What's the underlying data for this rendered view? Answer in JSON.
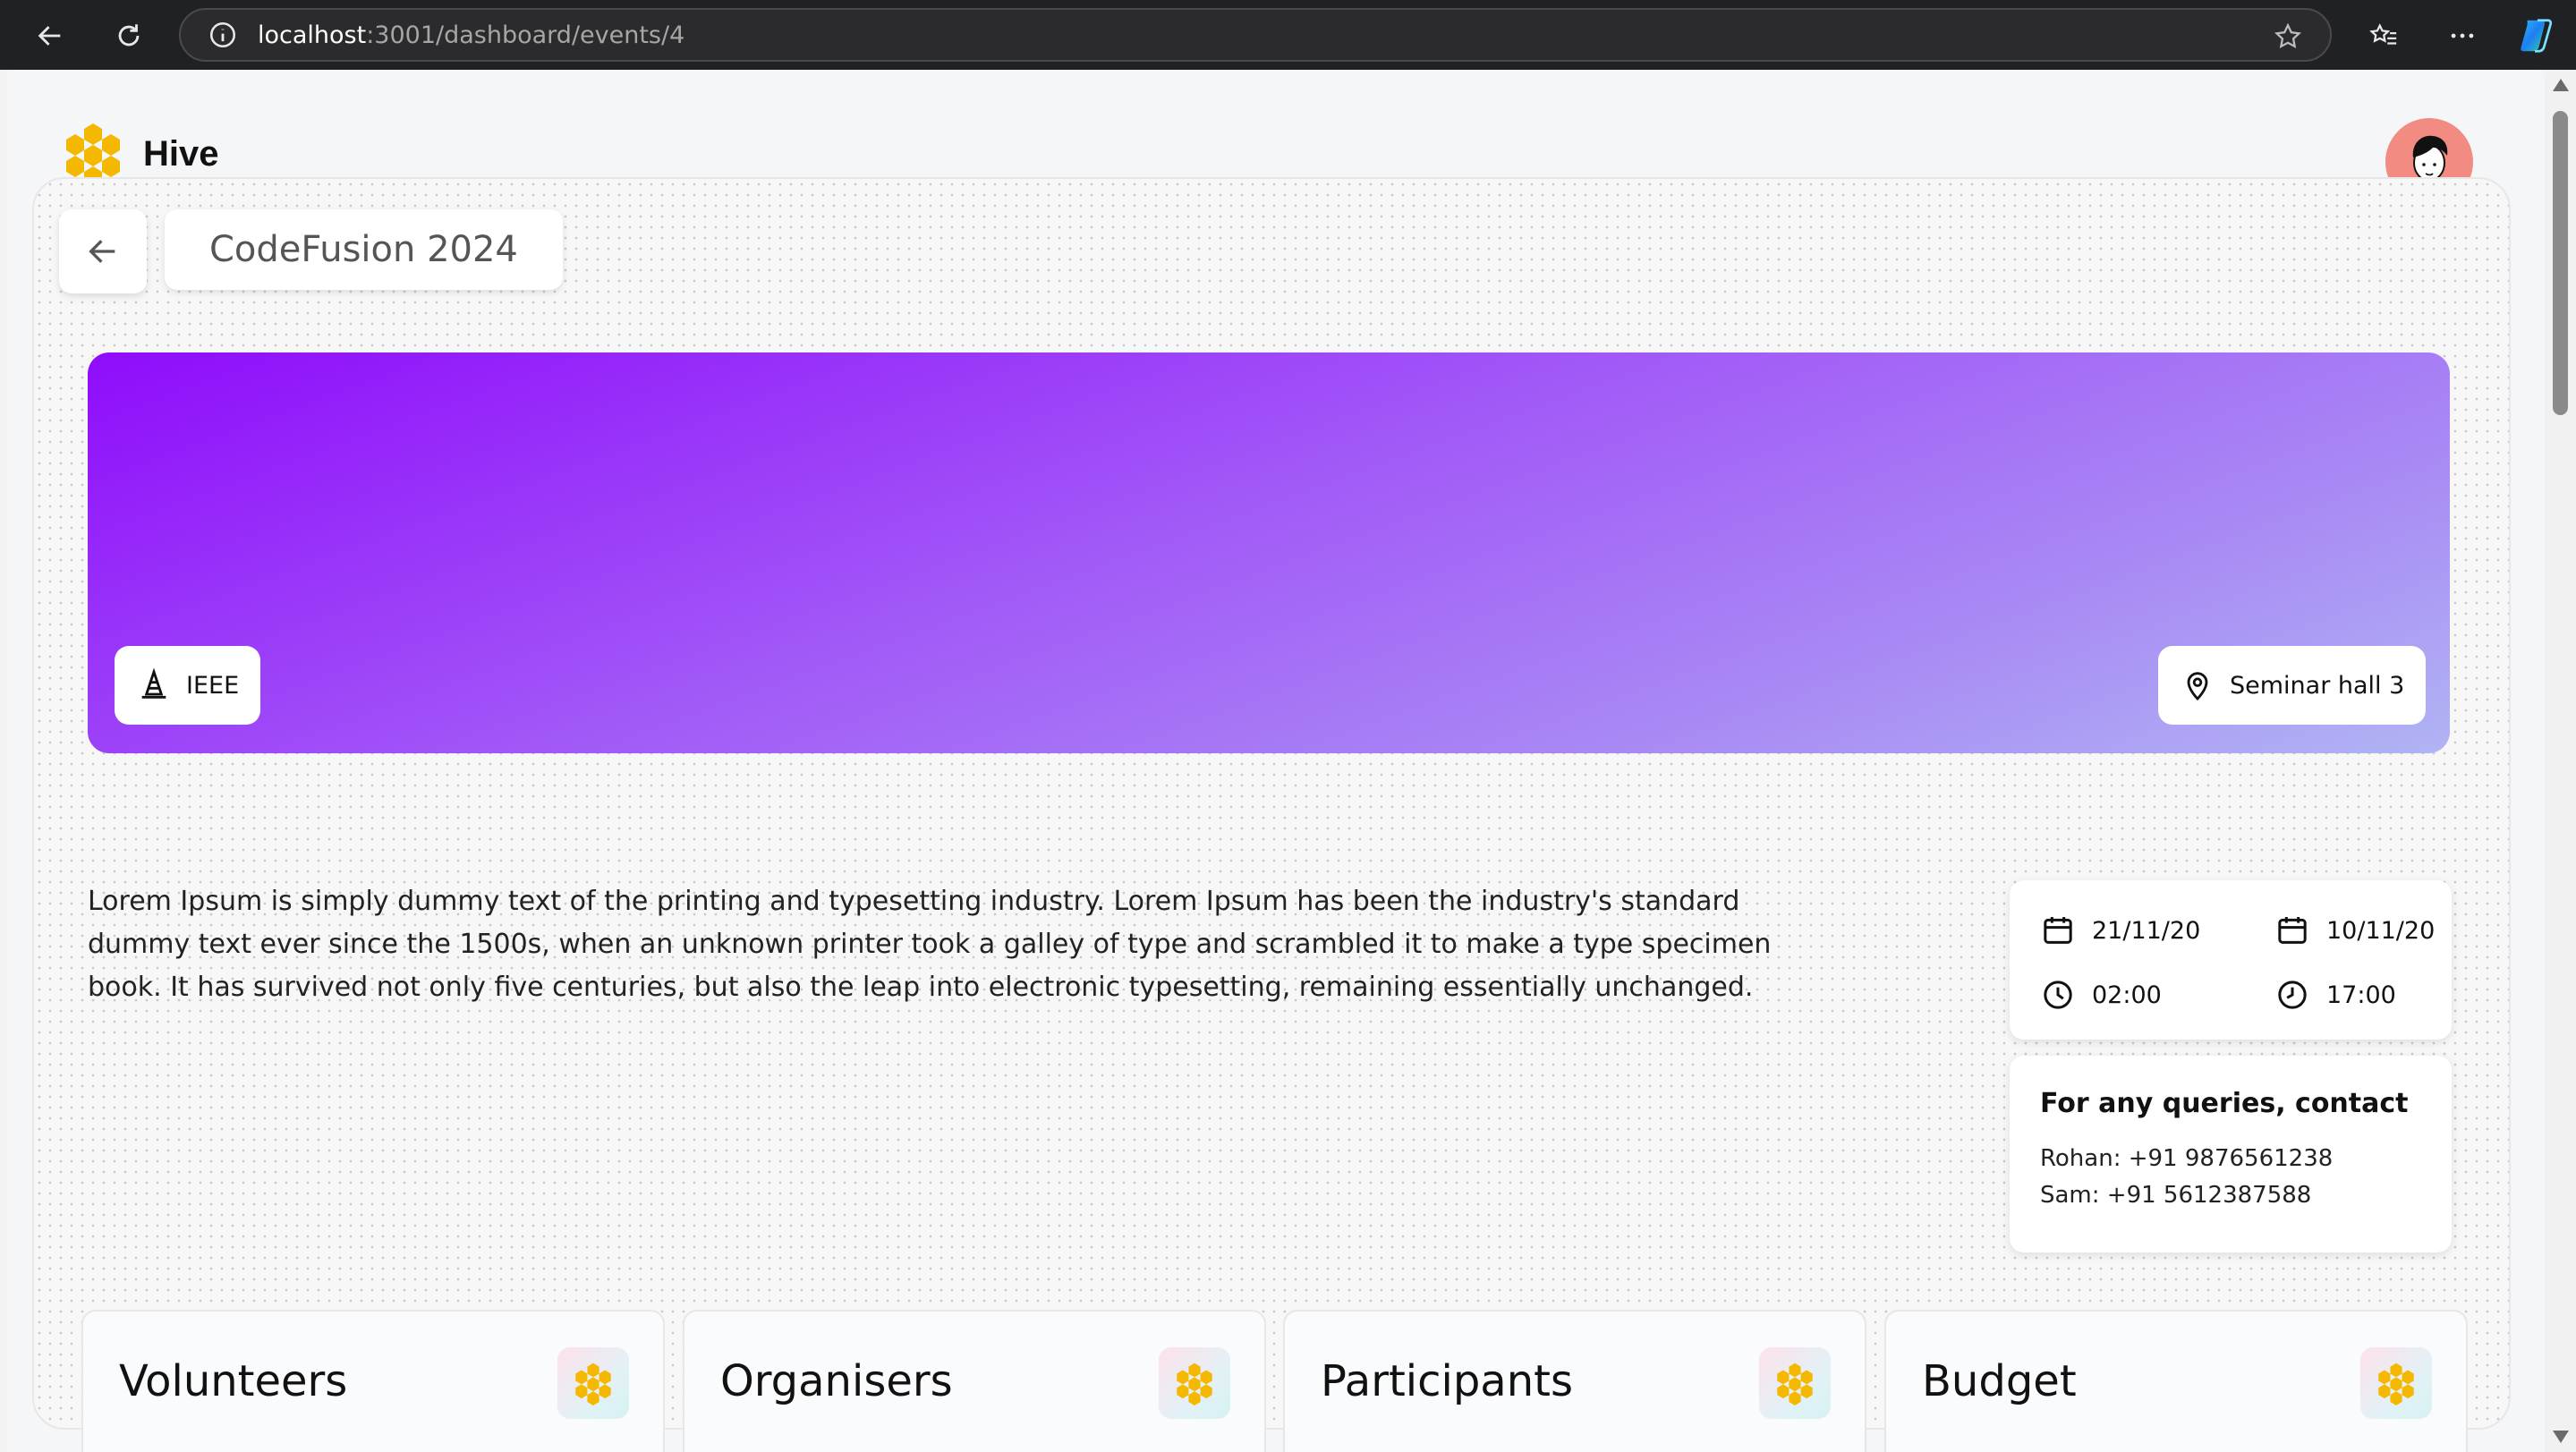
{
  "browser": {
    "url_host": "localhost",
    "url_rest": ":3001/dashboard/events/4"
  },
  "app": {
    "name": "Hive",
    "brand_color": "#F5B800"
  },
  "event": {
    "title": "CodeFusion 2024",
    "organizer": "IEEE",
    "location": "Seminar hall 3",
    "description": "Lorem Ipsum is simply dummy text of the printing and typesetting industry. Lorem Ipsum has been the industry's standard dummy text ever since the 1500s, when an unknown printer took a galley of type and scrambled it to make a type specimen book. It has survived not only five centuries, but also the leap into electronic typesetting, remaining essentially unchanged.",
    "banner_gradient": [
      "#8F0CFB",
      "#A259F7",
      "#A98DF4",
      "#B0B4F4"
    ],
    "start_date": "21/11/20",
    "end_date": "10/11/20",
    "start_time": "02:00",
    "end_time": "17:00"
  },
  "contact": {
    "heading": "For any queries, contact",
    "people": [
      {
        "name": "Rohan:",
        "phone": "+91 9876561238"
      },
      {
        "name": "Sam:",
        "phone": "+91 5612387588"
      }
    ]
  },
  "sections": [
    {
      "label": "Volunteers",
      "icon": "honeycomb-icon"
    },
    {
      "label": "Organisers",
      "icon": "honeycomb-icon"
    },
    {
      "label": "Participants",
      "icon": "honeycomb-icon"
    },
    {
      "label": "Budget",
      "icon": "honeycomb-icon"
    }
  ]
}
